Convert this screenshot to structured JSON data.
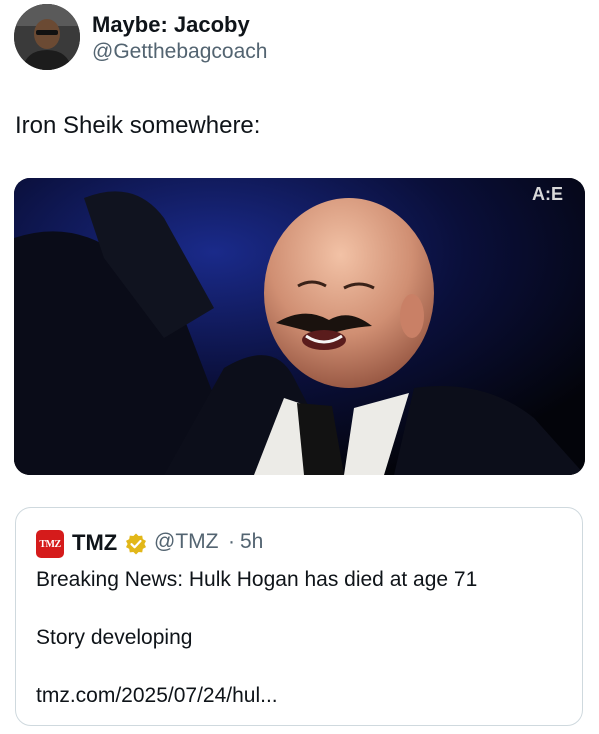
{
  "tweet": {
    "display_name": "Maybe: Jacoby",
    "handle": "@Getthebagcoach",
    "text": "Iron Sheik somewhere:",
    "media": {
      "watermark": "A:E"
    }
  },
  "quoted_tweet": {
    "logo_text": "TMZ",
    "display_name": "TMZ",
    "verified_badge_icon": "gold-verified-badge-icon",
    "handle": "@TMZ",
    "separator": "·",
    "time": "5h",
    "line1": "Breaking News: Hulk Hogan has died at age 71",
    "line2": "Story developing",
    "line3": "tmz.com/2025/07/24/hul..."
  },
  "colors": {
    "text_primary": "#0f1419",
    "text_secondary": "#536471",
    "border": "#cfd9de",
    "tmz_red": "#d51b1b",
    "badge_gold": "#e2b719"
  }
}
